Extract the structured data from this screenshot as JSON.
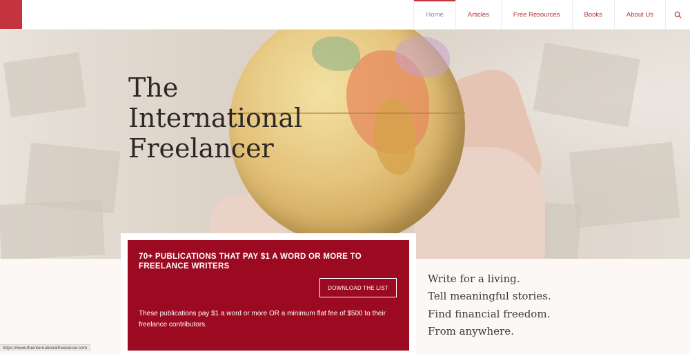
{
  "nav": {
    "items": [
      {
        "label": "Home",
        "active": true
      },
      {
        "label": "Articles",
        "active": false
      },
      {
        "label": "Free Resources",
        "active": false
      },
      {
        "label": "Books",
        "active": false
      },
      {
        "label": "About Us",
        "active": false
      }
    ],
    "search_icon": "search-icon"
  },
  "hero": {
    "title_lines": [
      "The",
      "International",
      "Freelancer"
    ]
  },
  "cta": {
    "heading": "70+ PUBLICATIONS THAT PAY $1 A WORD OR MORE TO FREELANCE WRITERS",
    "button_label": "DOWNLOAD THE LIST",
    "description": "These publications pay $1 a word or more OR a minimum flat fee of $500 to their freelance contributors."
  },
  "tagline": [
    "Write for a living.",
    "Tell meaningful stories.",
    "Find financial freedom.",
    "From anywhere."
  ],
  "status_url": "https://www.theinternationalfreelancer.com",
  "colors": {
    "brand": "#c4343f",
    "cta_background": "#9c0a22",
    "nav_text": "#b6323c"
  }
}
